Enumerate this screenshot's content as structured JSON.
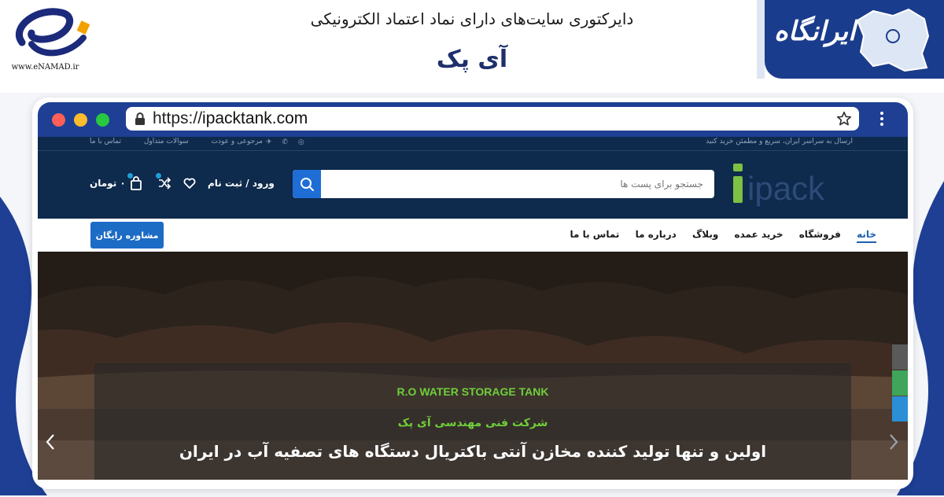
{
  "banner": {
    "enamad_domain": "www.eNAMAD.ir",
    "directory_title": "دایرکتوری سایت‌های دارای نماد اعتماد الکترونیکی",
    "site_name": "آی پک",
    "brand_name": "ایرانگاه"
  },
  "browser": {
    "url_prefix": "https://",
    "url_domain": "ipacktank.com"
  },
  "site": {
    "topbar": {
      "right_text": "ارسال به سراسر ایران، سریع و مطمئن خرید کنید",
      "left_links": [
        "مرجوعی و عودت",
        "سوالات متداول",
        "تماس با ما"
      ]
    },
    "logo_text": "ipack",
    "search": {
      "placeholder": "جستجو برای پست ها"
    },
    "header": {
      "login_label": "ورود / ثبت نام",
      "cart_total": "۰ تومان"
    },
    "nav": {
      "items": [
        "خانه",
        "فروشگاه",
        "خرید عمده",
        "وبلاگ",
        "درباره ما",
        "تماس با ما"
      ],
      "cta": "مشاوره رایگان"
    },
    "hero": {
      "subtitle": "R.O WATER STORAGE TANK",
      "company": "شرکت فنی مهندسی آی پک",
      "headline": "اولین و تنها تولید کننده مخازن آنتی باکتریال دستگاه های تصفیه آب در ایران"
    }
  },
  "colors": {
    "site_navy": "#0e2a4c",
    "accent_blue": "#1c6bc5",
    "hero_green": "#6fcf3a",
    "browser_chrome": "#1e3f94"
  }
}
